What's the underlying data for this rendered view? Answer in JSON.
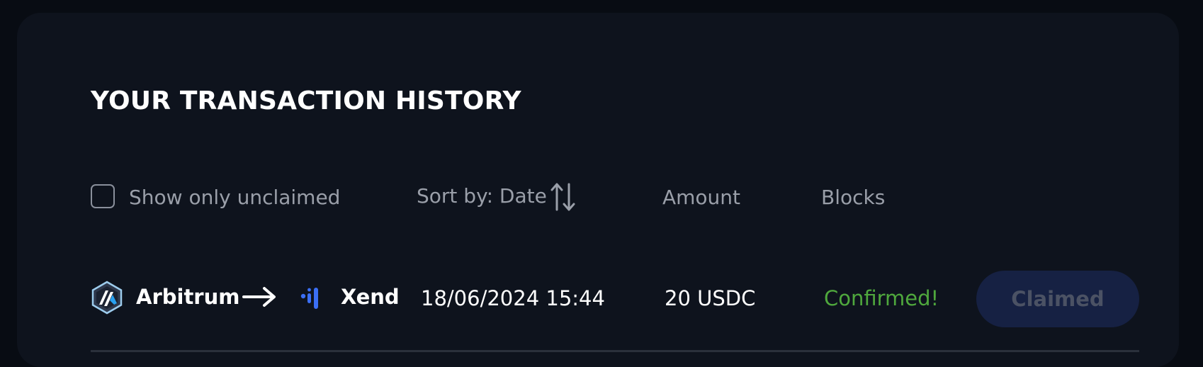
{
  "panel": {
    "title": "YOUR TRANSACTION HISTORY"
  },
  "filters": {
    "show_only_unclaimed_label": "Show only unclaimed",
    "show_only_unclaimed_checked": false,
    "sort_label": "Sort by: Date",
    "amount_header": "Amount",
    "blocks_header": "Blocks"
  },
  "transactions": [
    {
      "from_chain": "Arbitrum",
      "from_icon": "arbitrum-logo-icon",
      "to_chain": "Xend",
      "to_icon": "xend-logo-icon",
      "date": "18/06/2024 15:44",
      "amount": "20 USDC",
      "status": "Confirmed!",
      "action_label": "Claimed",
      "action_disabled": true
    }
  ],
  "colors": {
    "background": "#080c13",
    "panel": "#0e131d",
    "status_confirmed": "#4fa83d",
    "button_bg": "#162143",
    "button_text": "#4b5264",
    "muted_text": "#9a9fa9",
    "divider": "#2a303b"
  }
}
